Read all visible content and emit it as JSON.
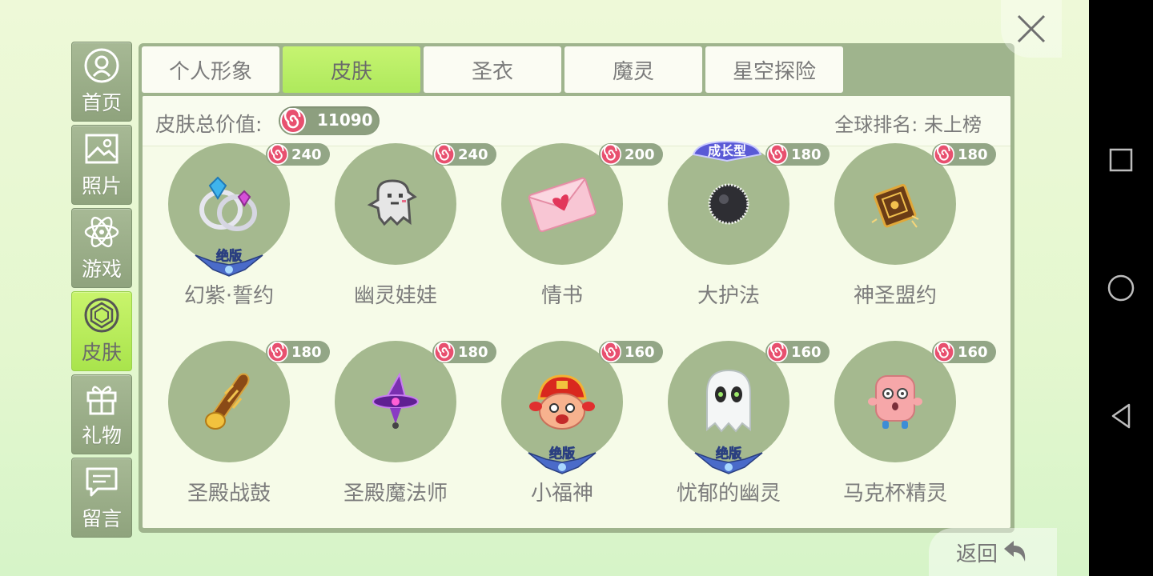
{
  "sidebar": {
    "items": [
      {
        "label": "首页",
        "icon": "home-icon"
      },
      {
        "label": "照片",
        "icon": "photo-icon"
      },
      {
        "label": "游戏",
        "icon": "atom-icon"
      },
      {
        "label": "皮肤",
        "icon": "gem-icon"
      },
      {
        "label": "礼物",
        "icon": "gift-icon"
      },
      {
        "label": "留言",
        "icon": "message-icon"
      }
    ],
    "active_index": 3
  },
  "tabs": [
    {
      "label": "个人形象"
    },
    {
      "label": "皮肤"
    },
    {
      "label": "圣衣"
    },
    {
      "label": "魔灵"
    },
    {
      "label": "星空探险"
    }
  ],
  "active_tab": 1,
  "summary": {
    "total_label": "皮肤总价值:",
    "total_value": "11090",
    "rank_label": "全球排名: 未上榜"
  },
  "items": [
    {
      "name": "幻紫·誓约",
      "price": "240",
      "badge": "绝版",
      "icon": "ring-icon"
    },
    {
      "name": "幽灵娃娃",
      "price": "240",
      "badge": "",
      "icon": "pixel-ghost-icon"
    },
    {
      "name": "情书",
      "price": "200",
      "badge": "",
      "icon": "love-letter-icon"
    },
    {
      "name": "大护法",
      "price": "180",
      "badge": "成长型",
      "icon": "black-ball-icon"
    },
    {
      "name": "神圣盟约",
      "price": "180",
      "badge": "",
      "icon": "golden-book-icon"
    },
    {
      "name": "圣殿战鼓",
      "price": "180",
      "badge": "",
      "icon": "war-horn-icon"
    },
    {
      "name": "圣殿魔法师",
      "price": "180",
      "badge": "",
      "icon": "wizard-hat-icon"
    },
    {
      "name": "小福神",
      "price": "160",
      "badge": "绝版",
      "icon": "fortune-god-icon"
    },
    {
      "name": "忧郁的幽灵",
      "price": "160",
      "badge": "绝版",
      "icon": "white-ghost-icon"
    },
    {
      "name": "马克杯精灵",
      "price": "160",
      "badge": "",
      "icon": "pink-cube-icon"
    }
  ],
  "back_label": "返回",
  "colors": {
    "active_green": "#b4ec5f",
    "panel": "#9fb48d",
    "candy_pink": "#e8506f"
  }
}
